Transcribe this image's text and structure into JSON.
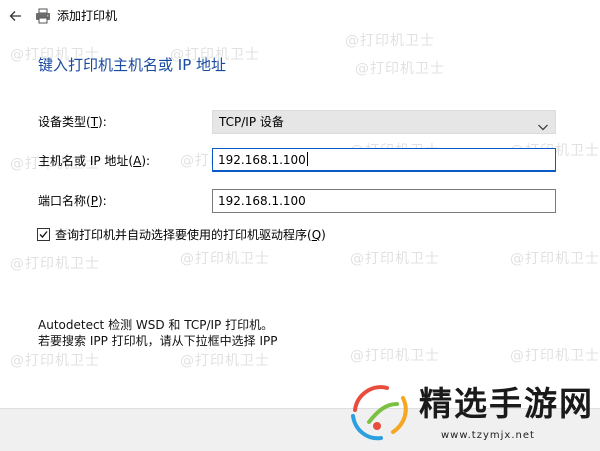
{
  "window": {
    "title": "添加打印机"
  },
  "heading": "键入打印机主机名或 IP 地址",
  "form": {
    "device_type": {
      "label_pre": "设备类型(",
      "accel": "T",
      "label_post": "):",
      "value": "TCP/IP 设备"
    },
    "hostname": {
      "label_pre": "主机名或 IP 地址(",
      "accel": "A",
      "label_post": "):",
      "value": "192.168.1.100"
    },
    "port_name": {
      "label_pre": "端口名称(",
      "accel": "P",
      "label_post": "):",
      "value": "192.168.1.100"
    },
    "query_checkbox": {
      "checked": true,
      "label_pre": "查询打印机并自动选择要使用的打印机驱动程序(",
      "accel": "Q",
      "label_post": ")"
    }
  },
  "info": {
    "line1": "Autodetect 检测 WSD 和 TCP/IP 打印机。",
    "line2": "若要搜索 IPP 打印机，请从下拉框中选择 IPP"
  },
  "watermark": {
    "text": "@打印机卫士"
  },
  "badge": {
    "name": "精选手游网",
    "url": "www.tzymjx.net"
  },
  "colors": {
    "heading": "#1a4ba2",
    "focus": "#0a59c4",
    "footer": "#f0f0f0"
  },
  "icons": {
    "back": "back-arrow-icon",
    "printer": "printer-icon",
    "dropdown": "chevron-down-icon",
    "check": "checkmark-icon"
  }
}
